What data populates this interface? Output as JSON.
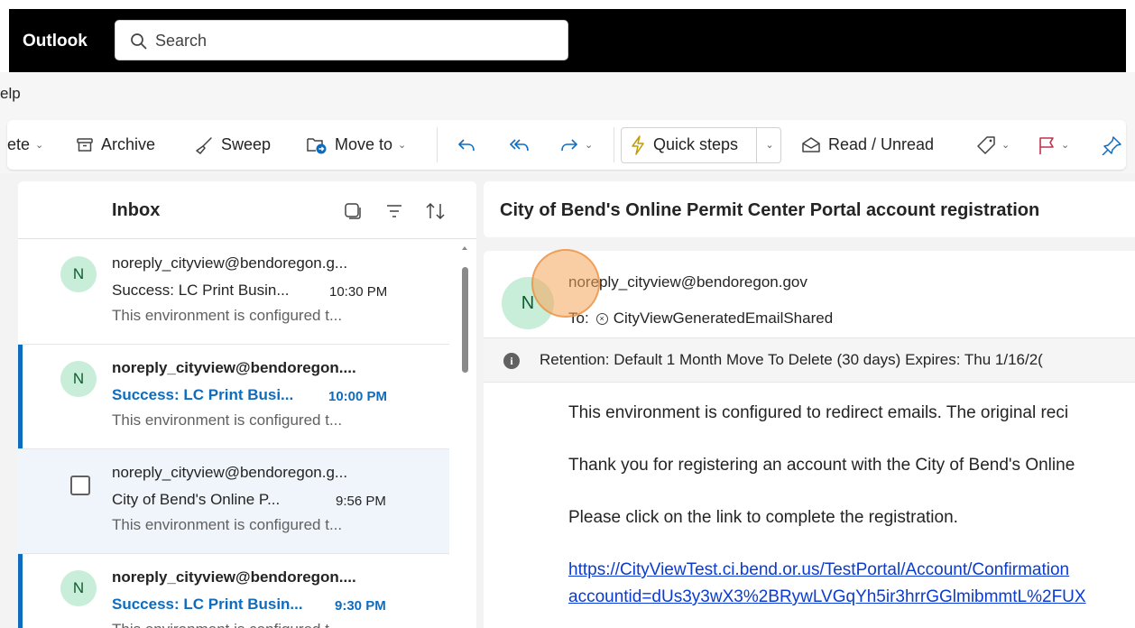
{
  "header": {
    "app_name": "Outlook",
    "search_placeholder": "Search"
  },
  "menu": {
    "help_partial": "elp"
  },
  "ribbon": {
    "delete_partial": "ete",
    "archive": "Archive",
    "sweep": "Sweep",
    "move_to": "Move to",
    "quick_steps": "Quick steps",
    "read_unread": "Read / Unread"
  },
  "list": {
    "title": "Inbox",
    "messages": [
      {
        "avatar": "N",
        "from": "noreply_cityview@bendoregon.g...",
        "subject": "Success: LC Print Busin...",
        "time": "10:30 PM",
        "preview": "This environment is configured t...",
        "unread": false,
        "selected": false
      },
      {
        "avatar": "N",
        "from": "noreply_cityview@bendoregon....",
        "subject": "Success: LC Print Busi...",
        "time": "10:00 PM",
        "preview": "This environment is configured t...",
        "unread": true,
        "selected": false
      },
      {
        "avatar": "",
        "from": "noreply_cityview@bendoregon.g...",
        "subject": "City of Bend's Online P...",
        "time": "9:56 PM",
        "preview": "This environment is configured t...",
        "unread": false,
        "selected": true
      },
      {
        "avatar": "N",
        "from": "noreply_cityview@bendoregon....",
        "subject": "Success: LC Print Busin...",
        "time": "9:30 PM",
        "preview": "This environment is configured t...",
        "unread": true,
        "selected": false
      }
    ]
  },
  "reading": {
    "subject": "City of Bend's Online Permit Center Portal account registration",
    "avatar": "N",
    "from": "noreply_cityview@bendoregon.gov",
    "to_label": "To:",
    "to_recipient": "CityViewGeneratedEmailShared",
    "retention": "Retention: Default 1 Month Move To Delete (30 days) Expires: Thu 1/16/2(",
    "body": [
      "This environment is configured to redirect emails.  The original reci",
      "Thank you for registering an account with the City of Bend's Online",
      "Please click on the link to complete the registration."
    ],
    "link_line1": "https://CityViewTest.ci.bend.or.us/TestPortal/Account/Confirmation",
    "link_line2": "accountid=dUs3y3wX3%2BRywLVGqYh5ir3hrrGGlmibmmtL%2FUX"
  }
}
